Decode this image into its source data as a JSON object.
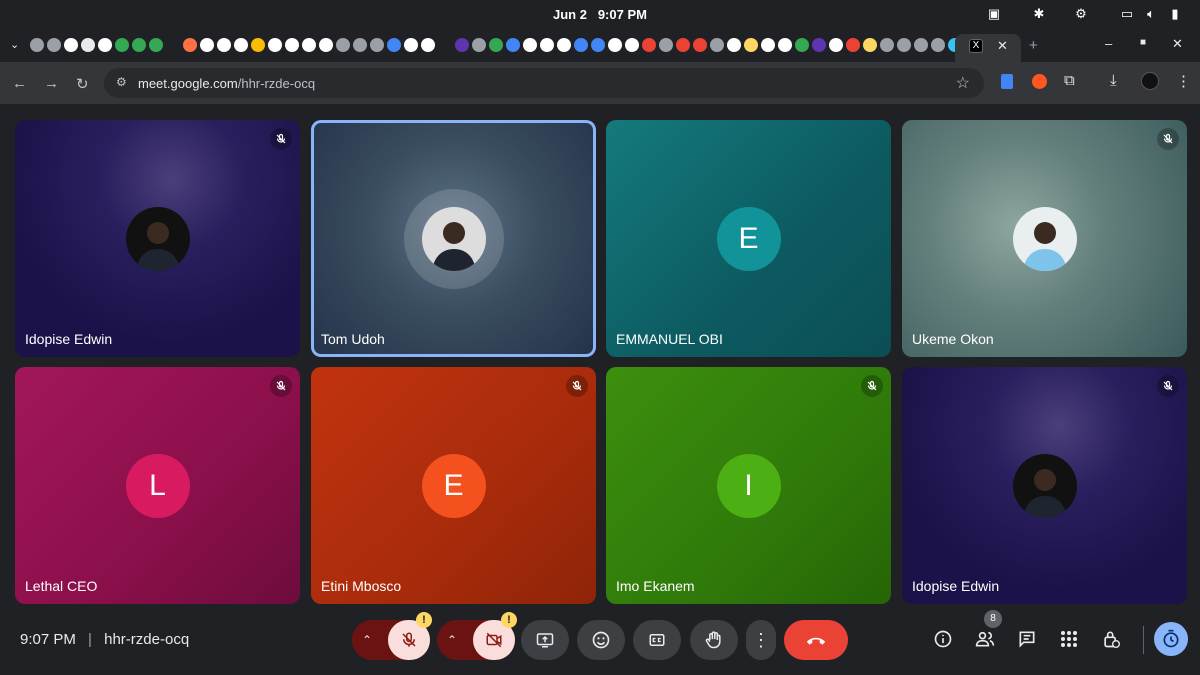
{
  "os_bar": {
    "date": "Jun 2",
    "time": "9:07 PM"
  },
  "browser": {
    "url_host": "meet.google.com",
    "url_path": "/hhr-rzde-ocq"
  },
  "participants": [
    {
      "name": "Idopise Edwin",
      "initial": "",
      "has_photo": true,
      "muted": true
    },
    {
      "name": "Tom Udoh",
      "initial": "",
      "has_photo": true,
      "muted": false,
      "speaking": true
    },
    {
      "name": "EMMANUEL OBI",
      "initial": "E",
      "has_photo": false,
      "muted": false
    },
    {
      "name": "Ukeme Okon",
      "initial": "",
      "has_photo": true,
      "muted": true
    },
    {
      "name": "Lethal CEO",
      "initial": "L",
      "has_photo": false,
      "muted": true
    },
    {
      "name": "Etini Mbosco",
      "initial": "E",
      "has_photo": false,
      "muted": true
    },
    {
      "name": "Imo Ekanem",
      "initial": "I",
      "has_photo": false,
      "muted": true
    },
    {
      "name": "Idopise Edwin",
      "initial": "",
      "has_photo": true,
      "muted": true
    }
  ],
  "footer": {
    "time": "9:07 PM",
    "separator": "|",
    "meeting_code": "hhr-rzde-ocq",
    "people_count": "8",
    "warning_mark": "!"
  },
  "colors": {
    "end_call": "#ea4335",
    "mic_off_bg": "#f9dedc",
    "accent": "#8ab4f8"
  }
}
